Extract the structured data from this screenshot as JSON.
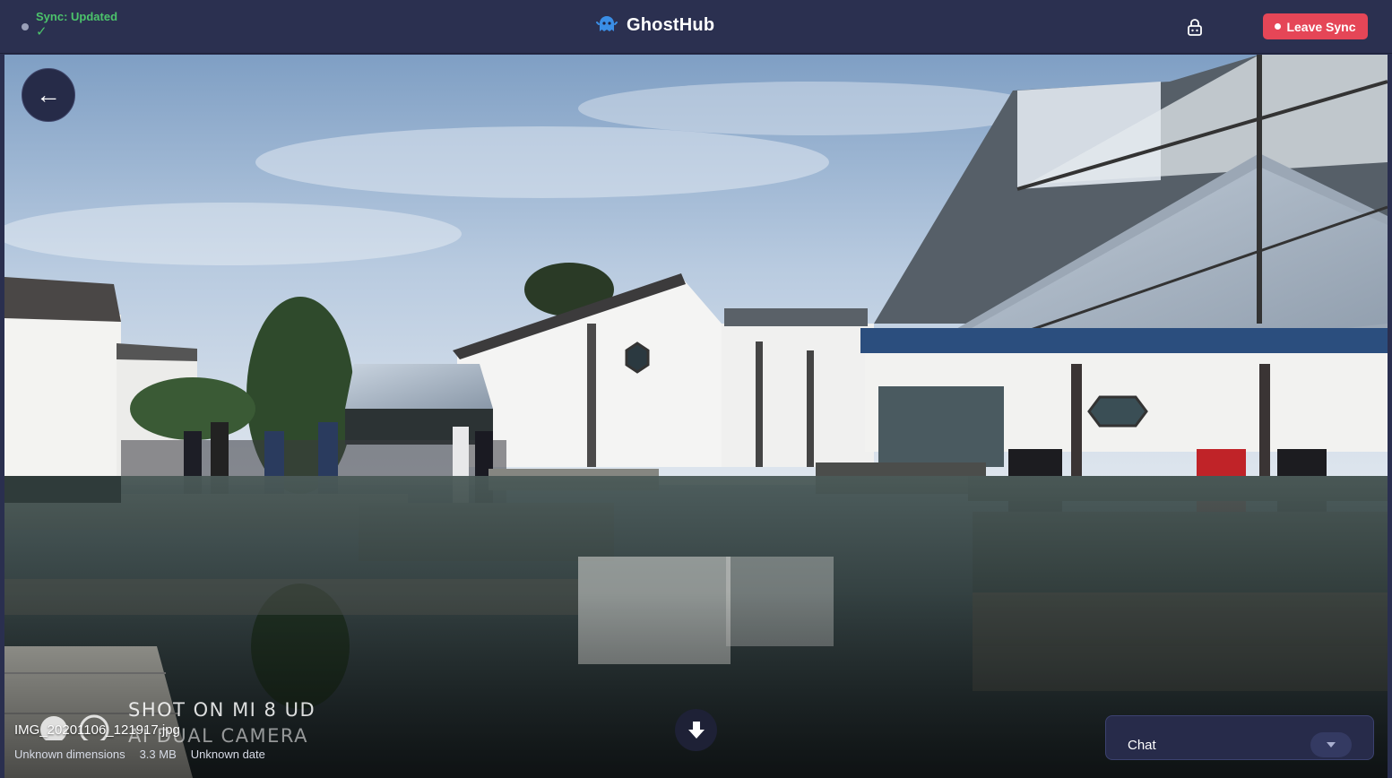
{
  "header": {
    "sync_status": "Sync: Updated",
    "sync_check": "✓",
    "app_title": "GhostHub",
    "leave_label": "Leave Sync"
  },
  "viewer": {
    "back_glyph": "←",
    "watermark": {
      "line1": "SHOT ON MI 8 UD",
      "line2": "AI DUAL CAMERA"
    },
    "file": {
      "name": "IMG_20201106_121917.jpg",
      "dimensions": "Unknown dimensions",
      "size": "3.3 MB",
      "date": "Unknown date"
    }
  },
  "chat": {
    "label": "Chat"
  },
  "icons": {
    "brand": "ghost-icon",
    "lock": "lock-icon",
    "back": "arrow-left-icon",
    "download": "download-icon",
    "chat_toggle": "chevron-down-icon"
  },
  "colors": {
    "header_bg": "#2b3050",
    "sync_green": "#4cc36b",
    "leave_red": "#e54657",
    "brand_blue": "#3a8ee6"
  }
}
